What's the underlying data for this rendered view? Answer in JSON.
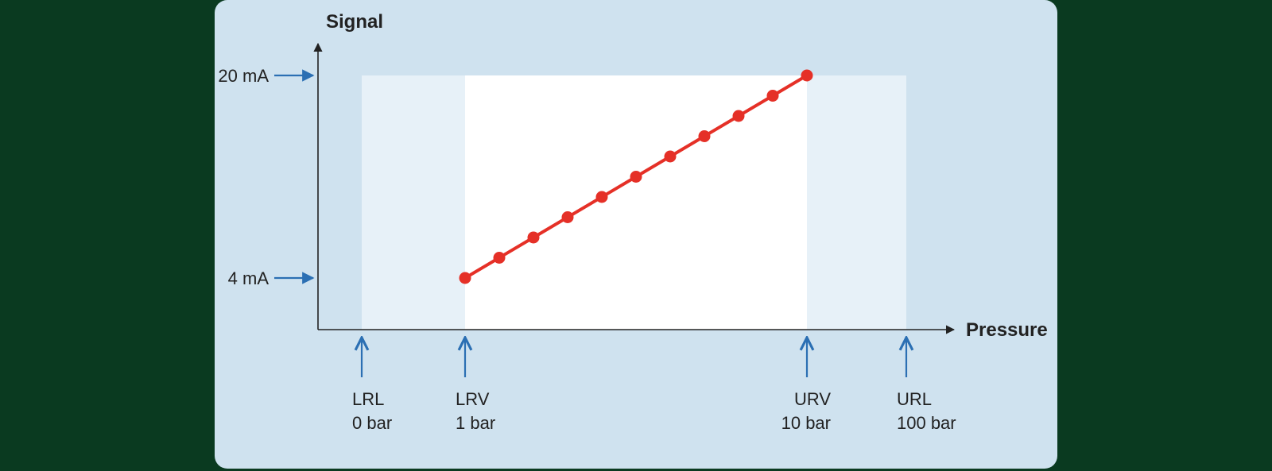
{
  "chart_data": {
    "type": "line",
    "title": "",
    "xlabel": "Pressure",
    "ylabel": "Signal",
    "x": [
      1,
      1.9,
      2.8,
      3.7,
      4.6,
      5.5,
      6.4,
      7.3,
      8.2,
      9.1,
      10
    ],
    "values": [
      4,
      5.6,
      7.2,
      8.8,
      10.4,
      12,
      13.6,
      15.2,
      16.8,
      18.4,
      20
    ],
    "ylim": [
      4,
      20
    ],
    "xlim": [
      0,
      100
    ],
    "y_ticks": [
      {
        "value": 4,
        "label": "4 mA"
      },
      {
        "value": 20,
        "label": "20 mA"
      }
    ],
    "x_annotations": [
      {
        "key": "LRL",
        "value_label": "0 bar",
        "value": 0
      },
      {
        "key": "LRV",
        "value_label": "1 bar",
        "value": 1
      },
      {
        "key": "URV",
        "value_label": "10 bar",
        "value": 10
      },
      {
        "key": "URL",
        "value_label": "100 bar",
        "value": 100
      }
    ],
    "colors": {
      "line": "#e53027",
      "point": "#e53027",
      "arrow": "#2b6fb3",
      "inner_bg": "#ffffff",
      "outer_bg": "#e7f1f8",
      "card_bg": "#cfe2ef"
    }
  }
}
